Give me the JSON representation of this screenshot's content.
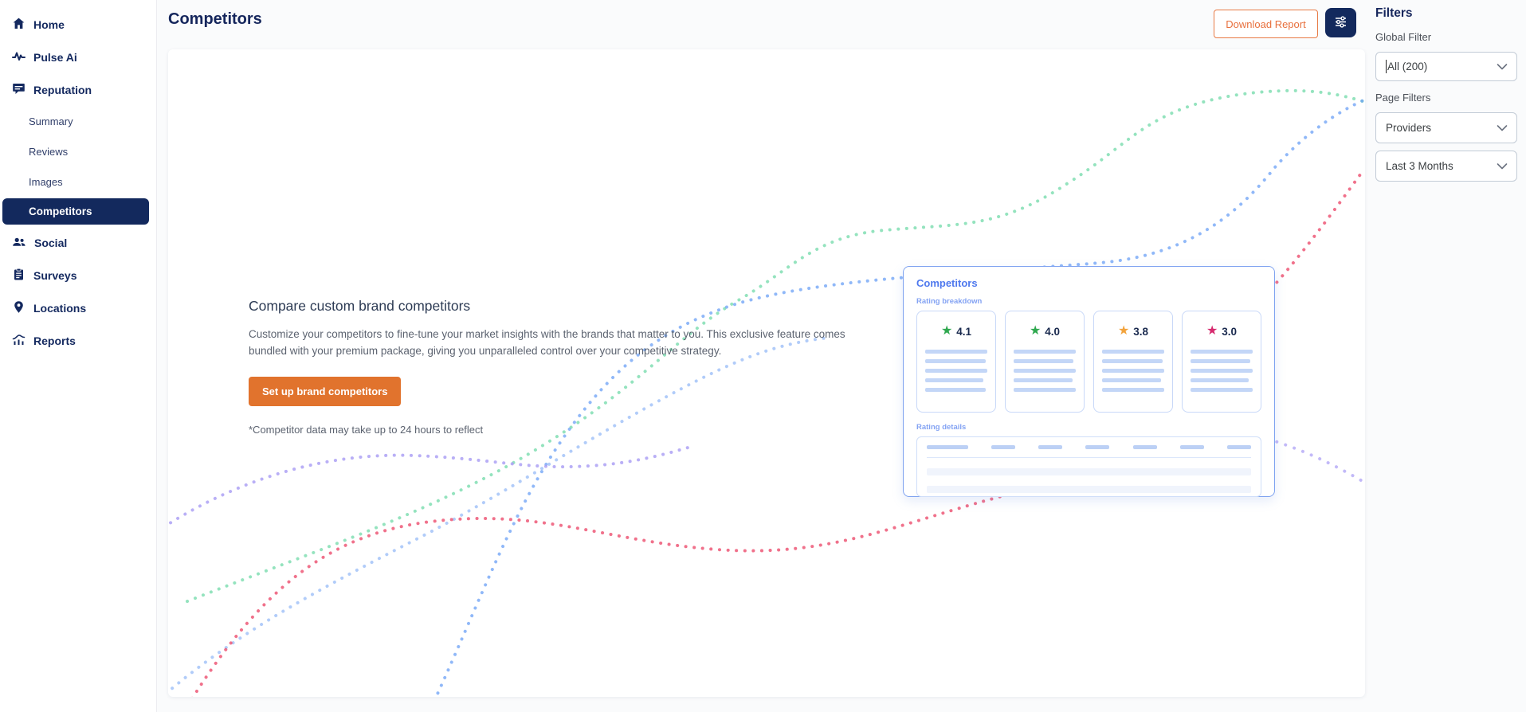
{
  "sidebar": {
    "items": [
      {
        "label": "Home"
      },
      {
        "label": "Pulse Ai"
      },
      {
        "label": "Reputation"
      },
      {
        "label": "Summary"
      },
      {
        "label": "Reviews"
      },
      {
        "label": "Images"
      },
      {
        "label": "Competitors"
      },
      {
        "label": "Social"
      },
      {
        "label": "Surveys"
      },
      {
        "label": "Locations"
      },
      {
        "label": "Reports"
      }
    ]
  },
  "header": {
    "title": "Competitors",
    "download_button": "Download Report"
  },
  "content": {
    "heading": "Compare custom brand competitors",
    "description": "Customize your competitors to fine-tune your market insights with the brands that matter to you. This exclusive feature comes bundled with your premium package, giving you unparalleled control over your competitive strategy.",
    "cta_button": "Set up brand competitors",
    "note": "*Competitor data may take up to 24 hours to reflect"
  },
  "preview_card": {
    "title": "Competitors",
    "rating_breakdown_label": "Rating breakdown",
    "rating_details_label": "Rating details",
    "ratings": [
      {
        "value": "4.1",
        "star_color": "#2fa84f"
      },
      {
        "value": "4.0",
        "star_color": "#2fa84f"
      },
      {
        "value": "3.8",
        "star_color": "#f2a33c"
      },
      {
        "value": "3.0",
        "star_color": "#d62a6e"
      }
    ]
  },
  "filters_panel": {
    "title": "Filters",
    "global_filter_label": "Global Filter",
    "global_filter_value": "All (200)",
    "page_filters_label": "Page Filters",
    "provider_filter_value": "Providers",
    "date_filter_value": "Last 3 Months"
  },
  "icons": {
    "star": "★"
  },
  "colors": {
    "brand_navy": "#13295d",
    "accent_orange": "#e1732d",
    "outline_orange": "#e8703d",
    "preview_blue": "#4f79ee",
    "skeleton_blue": "#c3d6f7",
    "curve_red": "#ec4d6e",
    "curve_blue": "#6ba0f6",
    "curve_green": "#79dcae",
    "curve_purple": "#a79bf4"
  }
}
